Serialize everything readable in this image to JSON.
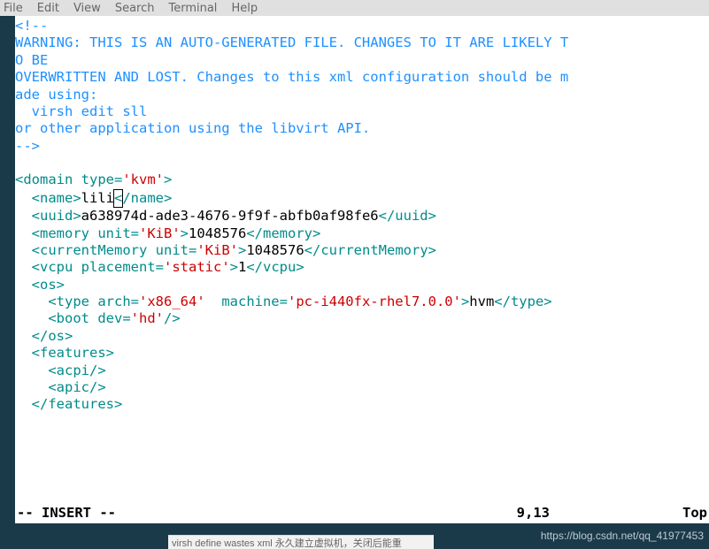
{
  "menu": {
    "file": "File",
    "edit": "Edit",
    "view": "View",
    "search": "Search",
    "terminal": "Terminal",
    "help": "Help"
  },
  "xml": {
    "comment_open": "<!--",
    "warn_l1": "WARNING: THIS IS AN AUTO-GENERATED FILE. CHANGES TO IT ARE LIKELY T",
    "warn_l2": "O BE",
    "warn_l3": "OVERWRITTEN AND LOST. Changes to this xml configuration should be m",
    "warn_l4": "ade using:",
    "warn_l5": "  virsh edit sll",
    "warn_l6": "or other application using the libvirt API.",
    "comment_close": "-->",
    "domain_open_a": "<domain",
    "domain_type_attr": " type=",
    "domain_type_val": "'kvm'",
    "domain_open_b": ">",
    "name_open": "<name>",
    "name_text": "lili",
    "name_cursor": "<",
    "name_close": "/name>",
    "uuid_open": "<uuid>",
    "uuid_text": "a638974d-ade3-4676-9f9f-abfb0af98fe6",
    "uuid_close": "</uuid>",
    "memory_open": "<memory",
    "memory_unit_attr": " unit=",
    "memory_unit_val": "'KiB'",
    "memory_open_b": ">",
    "memory_text": "1048576",
    "memory_close": "</memory>",
    "cmem_open": "<currentMemory",
    "cmem_unit_attr": " unit=",
    "cmem_unit_val": "'KiB'",
    "cmem_open_b": ">",
    "cmem_text": "1048576",
    "cmem_close": "</currentMemory>",
    "vcpu_open": "<vcpu",
    "vcpu_attr": " placement=",
    "vcpu_val": "'static'",
    "vcpu_open_b": ">",
    "vcpu_text": "1",
    "vcpu_close": "</vcpu>",
    "os_open": "<os>",
    "type_open": "<type",
    "type_arch_attr": " arch=",
    "type_arch_val": "'x86_64'",
    "type_mach_attr": "  machine=",
    "type_mach_val": "'pc-i440fx-rhel7.0.0'",
    "type_open_b": ">",
    "type_text": "hvm",
    "type_close": "</type>",
    "boot_open": "<boot",
    "boot_attr": " dev=",
    "boot_val": "'hd'",
    "boot_close": "/>",
    "os_close": "</os>",
    "feat_open": "<features>",
    "acpi": "<acpi/>",
    "apic": "<apic/>",
    "feat_close": "</features>"
  },
  "status": {
    "mode": "-- INSERT --",
    "pos": "9,13",
    "pct": "Top"
  },
  "watermark": "https://blog.csdn.net/qq_41977453",
  "bottom_text": "virsh define wastes xml 永久建立虚拟机，关闭后能重"
}
